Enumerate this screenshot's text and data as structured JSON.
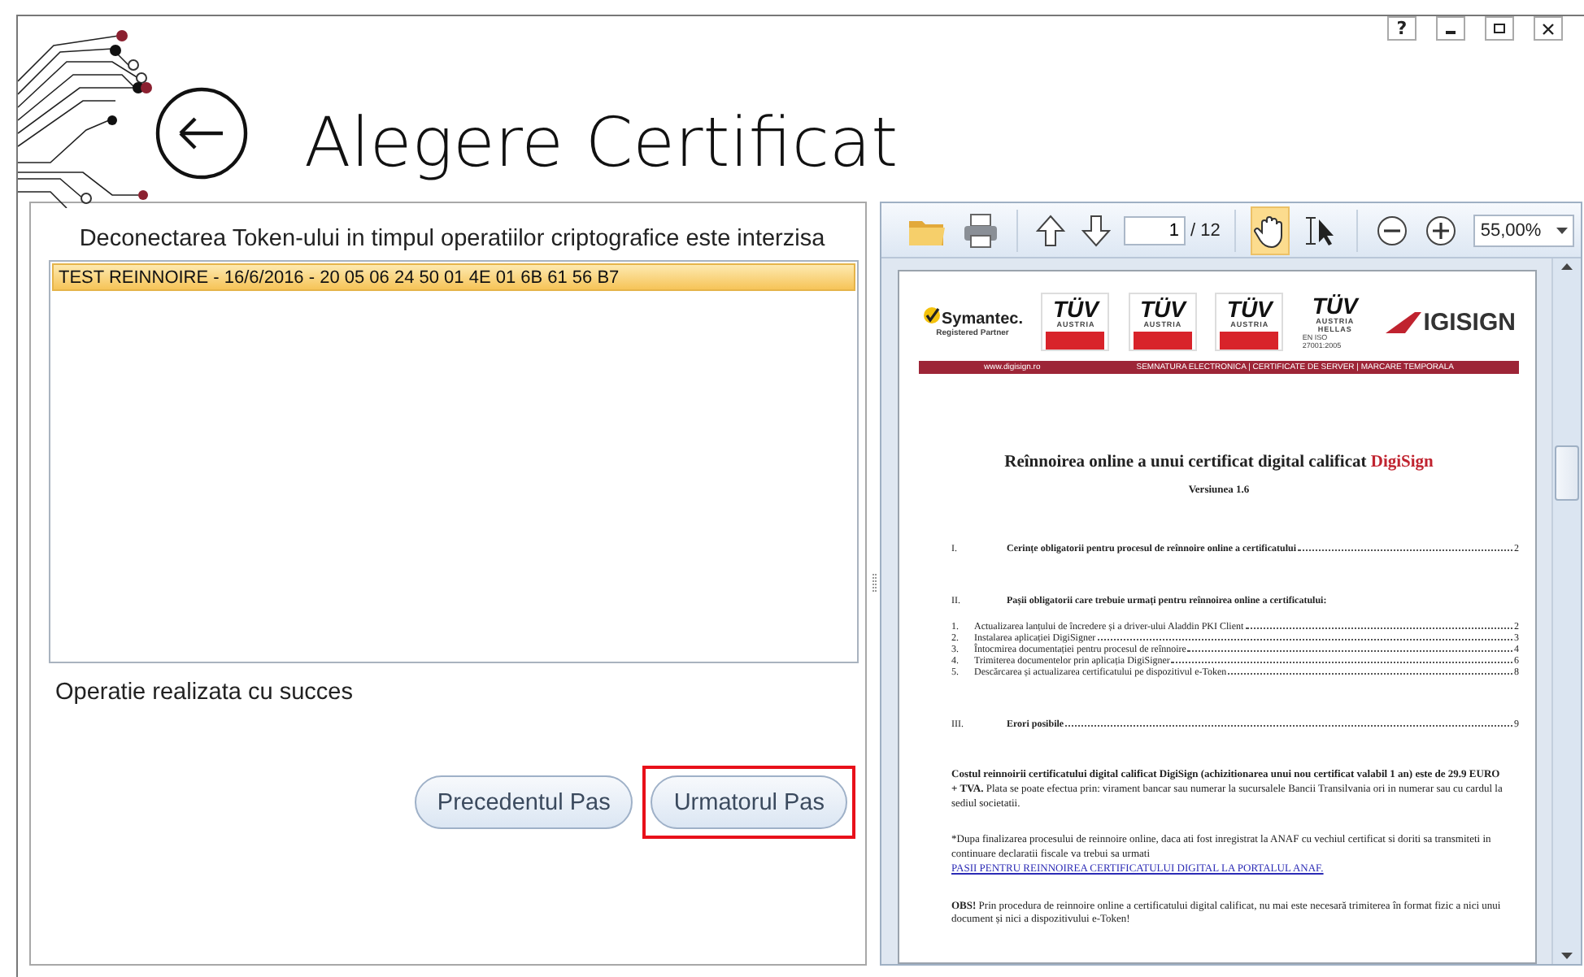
{
  "window": {
    "controls": [
      {
        "kind": "help",
        "label": "?"
      },
      {
        "kind": "minimize"
      },
      {
        "kind": "maximize"
      },
      {
        "kind": "close"
      }
    ]
  },
  "header": {
    "title": "Alegere Certificat"
  },
  "left_panel": {
    "warning": "Deconectarea Token-ului in timpul operatiilor criptografice este interzisa",
    "certificates": [
      {
        "label": "TEST REINNOIRE - 16/6/2016 - 20 05 06 24 50 01 4E 01 6B 61 56 B7",
        "selected": true
      }
    ],
    "status": "Operatie realizata cu succes",
    "buttons": [
      {
        "label": "Precedentul Pas",
        "highlighted": false
      },
      {
        "label": "Urmatorul Pas",
        "highlighted": true
      }
    ]
  },
  "pdf_viewer": {
    "toolbar": [
      {
        "kind": "open"
      },
      {
        "kind": "print"
      },
      {
        "kind": "separator"
      },
      {
        "kind": "page-up"
      },
      {
        "kind": "page-down"
      },
      {
        "kind": "page-field",
        "value": "1",
        "total": "/ 12"
      },
      {
        "kind": "separator"
      },
      {
        "kind": "hand",
        "selected": true
      },
      {
        "kind": "select",
        "selected": false
      },
      {
        "kind": "separator"
      },
      {
        "kind": "zoom-out"
      },
      {
        "kind": "zoom-in"
      },
      {
        "kind": "zoom-select",
        "value": "55,00%"
      }
    ],
    "document": {
      "partner": {
        "name": "Symantec.",
        "subtitle": "Registered Partner"
      },
      "certifications": [
        {
          "kind": "badge",
          "mark": "TÜV",
          "country": "AUSTRIA"
        },
        {
          "kind": "badge",
          "mark": "TÜV",
          "country": "AUSTRIA"
        },
        {
          "kind": "badge",
          "mark": "TÜV",
          "country": "AUSTRIA"
        },
        {
          "kind": "plain",
          "mark": "TÜV",
          "country": "AUSTRIA HELLAS",
          "standard": "EN ISO 27001:2005"
        }
      ],
      "brand_logo": "IGISIGN",
      "band": {
        "site": "www.digisign.ro",
        "services": "SEMNATURA ELECTRONICA | CERTIFICATE DE SERVER | MARCARE TEMPORALA"
      },
      "title": "Reînnoirea online a unui certificat digital calificat",
      "title_brand": "DigiSign",
      "version": "Versiunea 1.6",
      "toc": [
        {
          "number": "I.",
          "text": "Cerințe obligatorii pentru procesul de reînnoire online a certificatului",
          "page": "2"
        },
        {
          "number": "II.",
          "text": "Pașii obligatorii care trebuie urmați pentru reînnoirea online a certificatului:",
          "children": [
            {
              "number": "1.",
              "text": "Actualizarea lanțului de încredere și a driver-ului Aladdin PKI Client",
              "page": "2"
            },
            {
              "number": "2.",
              "text": "Instalarea aplicației DigiSigner",
              "page": "3"
            },
            {
              "number": "3.",
              "text": "Întocmirea documentației pentru procesul de reînnoire",
              "page": "4"
            },
            {
              "number": "4.",
              "text": "Trimiterea documentelor prin aplicația DigiSigner",
              "page": "6"
            },
            {
              "number": "5.",
              "text": "Descărcarea și actualizarea certificatului pe dispozitivul e-Token",
              "page": "8"
            }
          ]
        },
        {
          "number": "III.",
          "text": "Erori posibile",
          "page": "9"
        }
      ],
      "paragraphs": [
        {
          "text": "**Costul reinnoirii certificatului digital calificat DigiSign (achizitionarea unui nou certificat valabil 1 an) este de 29.9 EURO + TVA.** Plata se poate efectua prin: virament bancar sau numerar la sucursalele Bancii Transilvania ori in numerar sau cu cardul la sediul societatii."
        },
        {
          "text": "*Dupa finalizarea procesului de reinnoire online, daca ati fost inregistrat la ANAF cu vechiul certificat si doriti sa transmiteti in continuare declaratii fiscale va trebui sa urmati",
          "link": "PASII PENTRU REINNOIREA CERTIFICATULUI DIGITAL LA PORTALUL ANAF."
        },
        {
          "text": "**OBS!** Prin procedura de reinnoire online a certificatului digital calificat, nu mai este necesară trimiterea în format fizic a nici unui document și nici a dispozitivului e-Token!"
        }
      ]
    }
  }
}
